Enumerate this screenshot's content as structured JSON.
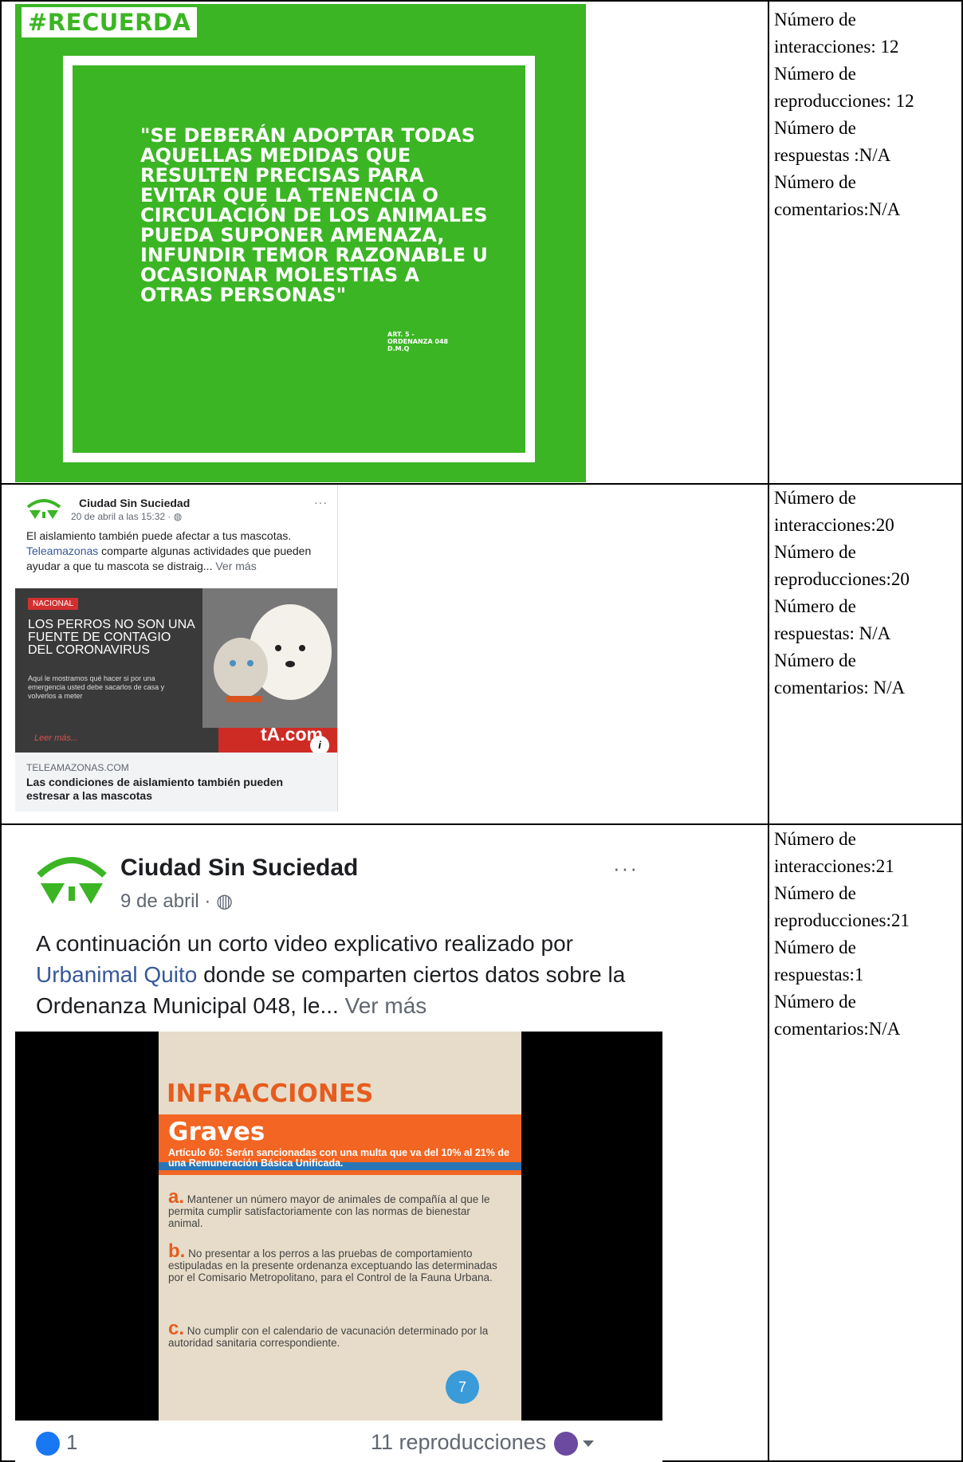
{
  "row1": {
    "poster": {
      "hashtag": "#RECUERDA",
      "quote": "\"SE DEBERÁN ADOPTAR TODAS AQUELLAS MEDIDAS QUE RESULTEN PRECISAS PARA EVITAR QUE LA TENENCIA O CIRCULACIÓN DE LOS ANIMALES PUEDA SUPONER AMENAZA, INFUNDIR TEMOR RAZONABLE U OCASIONAR MOLESTIAS A OTRAS PERSONAS\"",
      "source": "ART. 5 - ORDENANZA 048 D.M.Q"
    },
    "stats": [
      "Número de",
      "interacciones: 12",
      "Número de",
      "reproducciones: 12",
      "Número de",
      "respuestas :N/A",
      "Número de",
      "comentarios:N/A"
    ]
  },
  "row2": {
    "post": {
      "page_name": "Ciudad Sin Suciedad",
      "date": "20 de abril a las 15:32 ·",
      "more": "···",
      "text_before": "El aislamiento también puede afectar a tus mascotas.",
      "mention": "Teleamazonas",
      "text_after": "comparte algunas actividades que pueden ayudar a que tu mascota se distraig...",
      "see_more": "Ver más",
      "news_tag": "NACIONAL",
      "news_headline": "LOS PERROS NO SON UNA FUENTE DE CONTAGIO DEL CORONAVIRUS",
      "news_sub": "Aquí le mostramos qué hacer si por una emergencia usted debe sacarlos de casa y volverlos a meter",
      "news_leer": "Leer más...",
      "news_logo": "tA.com",
      "info": "i",
      "domain": "TELEAMAZONAS.COM",
      "link_title": "Las condiciones de aislamiento también pueden estresar a las mascotas"
    },
    "stats": [
      "Número de",
      "interacciones:20",
      "Número de",
      "reproducciones:20",
      "Número de",
      "respuestas: N/A",
      "Número de",
      "comentarios: N/A"
    ]
  },
  "row3": {
    "post": {
      "page_name": "Ciudad Sin Suciedad",
      "date": "9 de abril ·",
      "more": "···",
      "text_before": "A continuación un corto video explicativo realizado por",
      "mention": "Urbanimal Quito",
      "text_after": "donde se comparten ciertos datos sobre la Ordenanza Municipal 048, le...",
      "see_more": "Ver más",
      "slide_title": "INFRACCIONES",
      "slide_sub": "Graves",
      "slide_article": "Artículo 60: Serán sancionadas con una multa que va del 10% al 21% de una Remuneración Básica Unificada.",
      "items": [
        {
          "letter": "a.",
          "text": "Mantener un número mayor de animales de compañía al que le permita cumplir satisfactoriamente con las normas de bienestar animal."
        },
        {
          "letter": "b.",
          "text": "No presentar a los perros a las pruebas de comportamiento estipuladas en la presente ordenanza exceptuando las determinadas por el Comisario Metropolitano, para el Control de la Fauna Urbana."
        },
        {
          "letter": "c.",
          "text": "No cumplir con el calendario de vacunación determinado por la autoridad sanitaria correspondiente."
        }
      ],
      "slide_number": "7",
      "likes": "1",
      "views": "11 reproducciones"
    },
    "stats": [
      "Número de",
      "interacciones:21",
      "Número de",
      "reproducciones:21",
      "Número de",
      "respuestas:1",
      "Número de",
      "comentarios:N/A"
    ]
  },
  "colors": {
    "poster_green": "#3bb524",
    "fb_link": "#365899",
    "accent_orange": "#f26522"
  }
}
